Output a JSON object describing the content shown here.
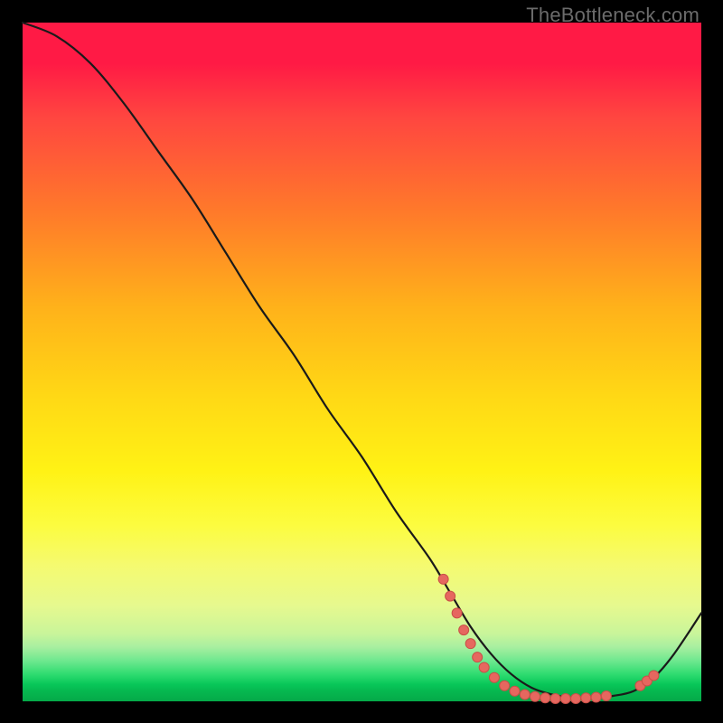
{
  "watermark": "TheBottleneck.com",
  "colors": {
    "gradient_top": "#ff1a45",
    "gradient_mid": "#fff215",
    "gradient_bottom": "#05a948",
    "curve": "#1a1a1a",
    "dot_fill": "#e6675f",
    "dot_stroke": "#c94f47",
    "background": "#000000"
  },
  "chart_data": {
    "type": "line",
    "title": "",
    "xlabel": "",
    "ylabel": "",
    "xlim": [
      0,
      100
    ],
    "ylim": [
      0,
      100
    ],
    "grid": false,
    "series": [
      {
        "name": "bottleneck-curve",
        "x": [
          0,
          5,
          10,
          15,
          20,
          25,
          30,
          35,
          40,
          45,
          50,
          55,
          60,
          63,
          66,
          69,
          72,
          75,
          78,
          81,
          84,
          87,
          90,
          93,
          96,
          100
        ],
        "y": [
          100,
          98,
          94,
          88,
          81,
          74,
          66,
          58,
          51,
          43,
          36,
          28,
          21,
          16,
          11,
          7,
          4,
          2,
          1,
          0.5,
          0.5,
          0.8,
          1.5,
          3.5,
          7,
          13
        ]
      }
    ],
    "markers": [
      {
        "x": 62,
        "y": 18
      },
      {
        "x": 63,
        "y": 15.5
      },
      {
        "x": 64,
        "y": 13
      },
      {
        "x": 65,
        "y": 10.5
      },
      {
        "x": 66,
        "y": 8.5
      },
      {
        "x": 67,
        "y": 6.5
      },
      {
        "x": 68,
        "y": 5
      },
      {
        "x": 69.5,
        "y": 3.5
      },
      {
        "x": 71,
        "y": 2.3
      },
      {
        "x": 72.5,
        "y": 1.5
      },
      {
        "x": 74,
        "y": 1
      },
      {
        "x": 75.5,
        "y": 0.7
      },
      {
        "x": 77,
        "y": 0.5
      },
      {
        "x": 78.5,
        "y": 0.4
      },
      {
        "x": 80,
        "y": 0.4
      },
      {
        "x": 81.5,
        "y": 0.4
      },
      {
        "x": 83,
        "y": 0.5
      },
      {
        "x": 84.5,
        "y": 0.6
      },
      {
        "x": 86,
        "y": 0.8
      },
      {
        "x": 91,
        "y": 2.3
      },
      {
        "x": 92,
        "y": 3
      },
      {
        "x": 93,
        "y": 3.8
      }
    ],
    "annotations": []
  }
}
